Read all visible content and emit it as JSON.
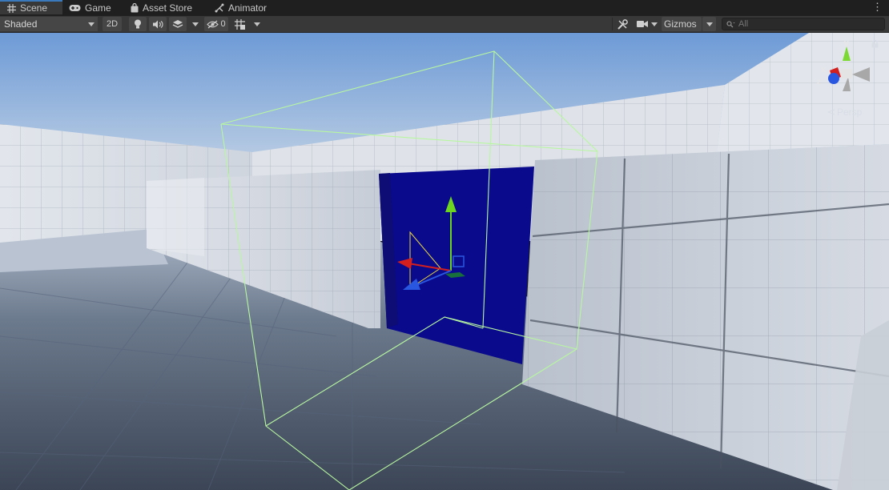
{
  "tabs": [
    {
      "label": "Scene",
      "icon": "grid-hash-icon",
      "active": true
    },
    {
      "label": "Game",
      "icon": "gamepad-icon",
      "active": false
    },
    {
      "label": "Asset Store",
      "icon": "shopping-bag-icon",
      "active": false
    },
    {
      "label": "Animator",
      "icon": "animator-icon",
      "active": false
    }
  ],
  "toolbar": {
    "draw_mode": "Shaded",
    "mode_2d": "2D",
    "hidden_count": "0",
    "gizmos_label": "Gizmos",
    "search_placeholder": "All"
  },
  "scene_gizmo": {
    "axis_y": "y",
    "axis_x": "x",
    "axis_z": "z",
    "projection": "Persp"
  },
  "colors": {
    "selected_object": "#0a0a8c",
    "bounds_outline": "#b8f7a0",
    "axis_x": "#d41f1f",
    "axis_y": "#6dd51f",
    "axis_z": "#2a57e0",
    "sky_top": "#6d9ad6",
    "tab_accent": "#3a79bb"
  }
}
